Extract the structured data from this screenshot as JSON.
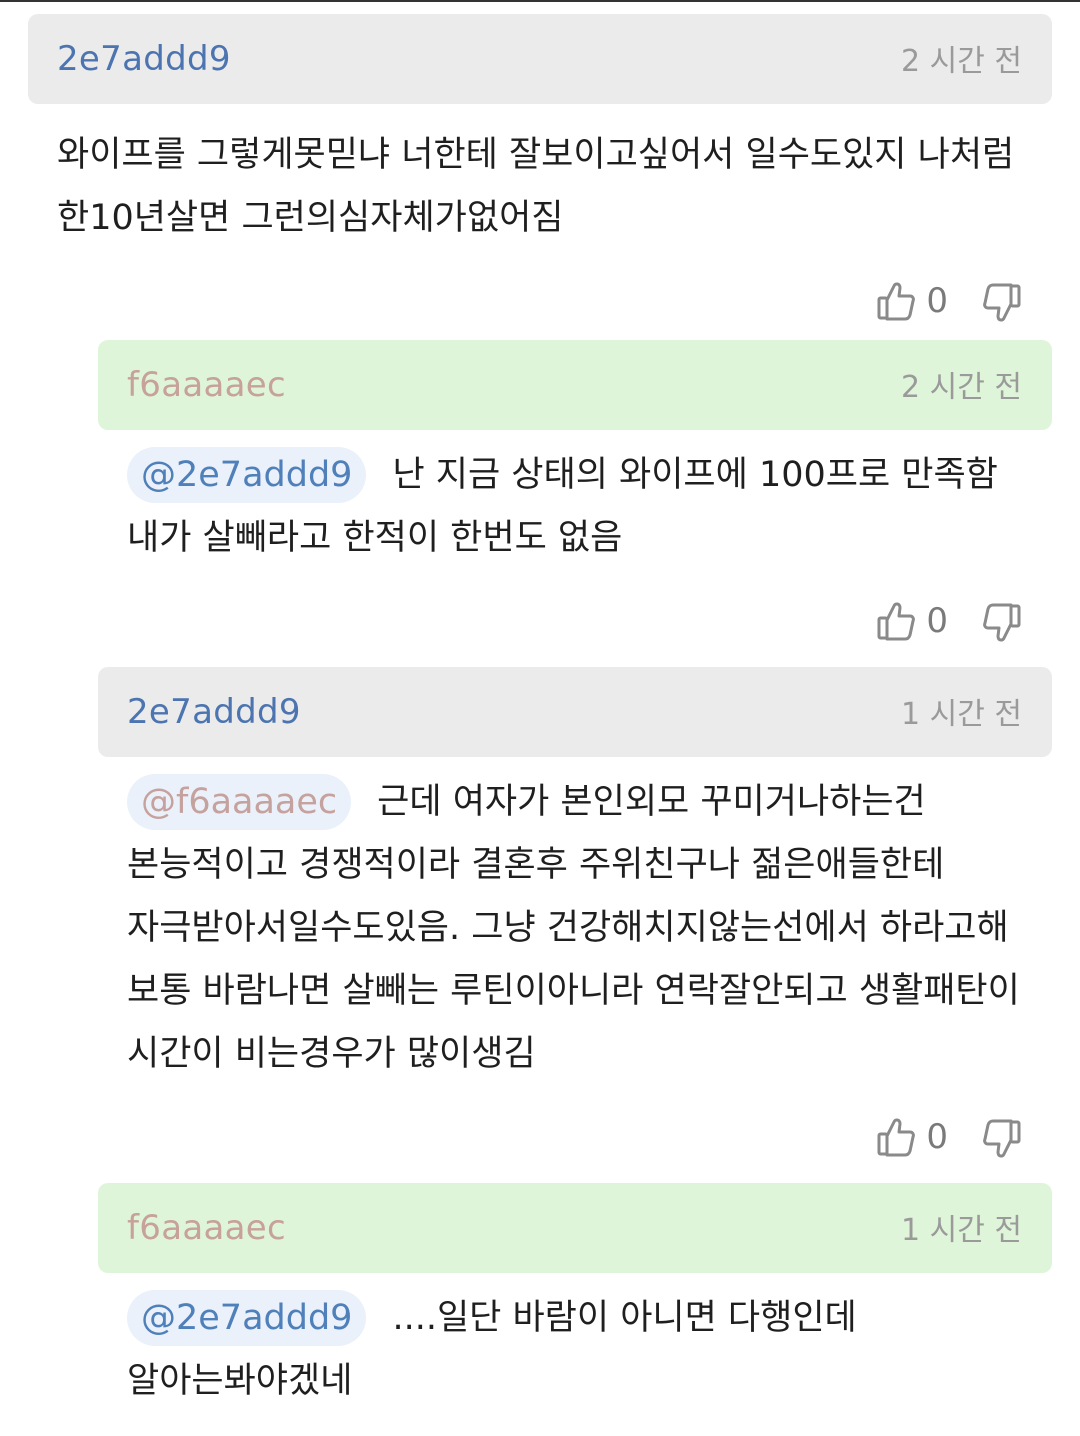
{
  "comments": [
    {
      "user": "2e7addd9",
      "time": "2 시간 전",
      "mention": "",
      "text": "와이프를 그렇게못믿냐 너한테 잘보이고싶어서 일수도있지 나처럼 한10년살면 그런의심자체가없어짐",
      "likes": "0"
    },
    {
      "user": "f6aaaaec",
      "time": "2 시간 전",
      "mention": "@2e7addd9",
      "text": "난 지금 상태의 와이프에 100프로 만족함 내가 살빼라고 한적이 한번도 없음",
      "likes": "0"
    },
    {
      "user": "2e7addd9",
      "time": "1 시간 전",
      "mention": "@f6aaaaec",
      "text": "근데 여자가 본인외모 꾸미거나하는건 본능적이고 경쟁적이라 결혼후 주위친구나 젊은애들한테 자극받아서일수도있음. 그냥 건강해치지않는선에서 하라고해 보통 바람나면 살빼는 루틴이아니라 연락잘안되고 생활패탄이 시간이 비는경우가 많이생김",
      "likes": "0"
    },
    {
      "user": "f6aaaaec",
      "time": "1 시간 전",
      "mention": "@2e7addd9",
      "text": "....일단 바람이 아니면 다행인데 알아는봐야겠네"
    }
  ],
  "colors": {
    "user_blue": "#4b74b0",
    "user_pink": "#c7a19b",
    "header_gray": "#ebebeb",
    "header_green": "#dff5d9",
    "mention_bg": "#eaf1fa"
  },
  "icons": [
    "thumbs-up-icon",
    "thumbs-down-icon"
  ]
}
